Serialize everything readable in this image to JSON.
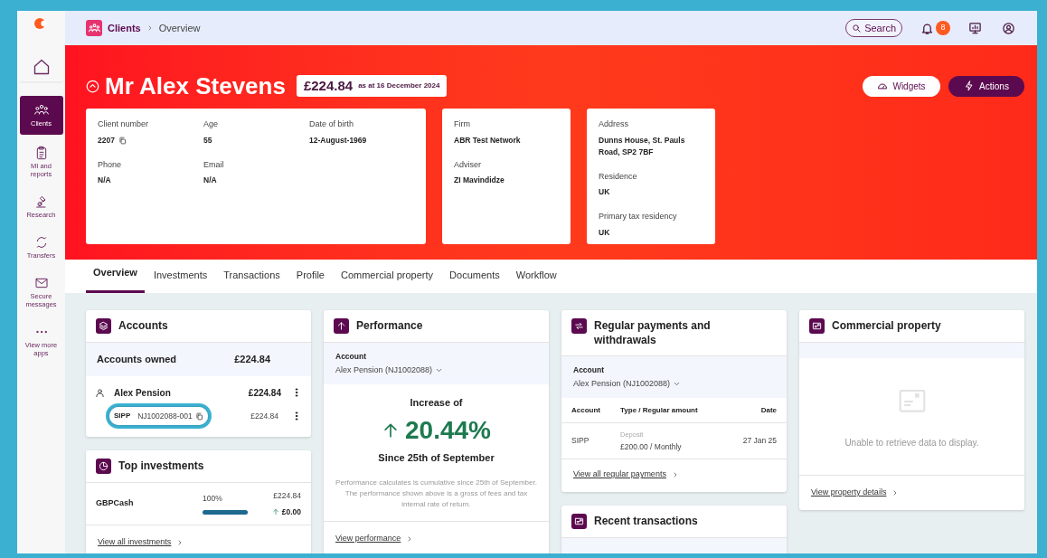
{
  "sidebar": {
    "items": [
      {
        "kind": "home",
        "selected": false
      },
      {
        "kind": "clients",
        "label": "Clients",
        "selected": true
      },
      {
        "kind": "reports",
        "label": "MI and reports",
        "selected": false
      },
      {
        "kind": "research",
        "label": "Research",
        "selected": false
      },
      {
        "kind": "transfers",
        "label": "Transfers",
        "selected": false
      },
      {
        "kind": "messages",
        "label": "Secure messages",
        "selected": false
      },
      {
        "kind": "more",
        "label": "View more apps",
        "selected": false
      }
    ]
  },
  "topbar": {
    "breadcrumb": [
      "Clients",
      "Overview"
    ],
    "search": "Search",
    "notification_count": "8"
  },
  "client": {
    "name": "Mr Alex Stevens",
    "value": "£224.84",
    "as_at": "as at 16 December 2024",
    "actions": [
      {
        "kind": "widgets",
        "label": "Widgets"
      },
      {
        "kind": "actions",
        "label": "Actions"
      }
    ]
  },
  "info_cards": [
    {
      "fields": [
        {
          "label": "Client number",
          "value": "2207",
          "copyable": true
        },
        {
          "label": "Age",
          "value": "55",
          "copyable": false
        },
        {
          "label": "Date of birth",
          "value": "12-August-1969",
          "copyable": false
        },
        {
          "label": "Phone",
          "value": "N/A",
          "copyable": false
        },
        {
          "label": "Email",
          "value": "N/A",
          "copyable": false
        }
      ]
    },
    {
      "fields": [
        {
          "label": "Firm",
          "value": "ABR Test Network",
          "copyable": false
        },
        {
          "label": "Adviser",
          "value": "ZI Mavindidze",
          "copyable": false
        }
      ]
    },
    {
      "fields": [
        {
          "label": "Address",
          "value": "Dunns House, St. Pauls Road, SP2 7BF",
          "copyable": false
        },
        {
          "label": "Residence",
          "value": "UK",
          "copyable": false
        },
        {
          "label": "Primary tax residency",
          "value": "UK",
          "copyable": false
        }
      ]
    }
  ],
  "tabs": [
    {
      "label": "Overview",
      "selected": true
    },
    {
      "label": "Investments",
      "selected": false
    },
    {
      "label": "Transactions",
      "selected": false
    },
    {
      "label": "Profile",
      "selected": false
    },
    {
      "label": "Commercial property",
      "selected": false
    },
    {
      "label": "Documents",
      "selected": false
    },
    {
      "label": "Workflow",
      "selected": false
    }
  ],
  "accounts": {
    "title": "Accounts",
    "summary_label": "Accounts owned",
    "summary_value": "£224.84",
    "accounts": [
      {
        "name": "Alex Pension",
        "value": "£224.84",
        "products": [
          {
            "type": "SIPP",
            "number": "NJ1002088-001",
            "value": "£224.84",
            "highlighted": true
          }
        ]
      }
    ]
  },
  "top_investments": {
    "title": "Top investments",
    "rows": [
      {
        "name": "GBPCash",
        "share": "100%",
        "level": 1,
        "value": "£224.84",
        "change": "£0.00"
      }
    ],
    "link": "View all investments"
  },
  "performance": {
    "title": "Performance",
    "account_label": "Account",
    "account": "Alex Pension (NJ1002088)",
    "heading": "Increase of",
    "change": "20.44%",
    "since": "Since 25th of September",
    "note": "Performance calculates is cumulative since 25th of September. The performance shown above is a gross of fees and tax internal rate of return.",
    "link": "View performance"
  },
  "regular_payments": {
    "title": "Regular payments and withdrawals",
    "account_label": "Account",
    "account": "Alex Pension (NJ1002088)",
    "columns": [
      "Account",
      "Type / Regular amount",
      "Date"
    ],
    "rows": [
      {
        "account": "SIPP",
        "type": "Deposit",
        "amount": "£200.00 / Monthly",
        "date": "27 Jan 25"
      }
    ],
    "link": "View all regular payments"
  },
  "recent_transactions": {
    "title": "Recent transactions"
  },
  "commercial_property": {
    "title": "Commercial property",
    "message": "Unable to retrieve data to display.",
    "link": "View property details"
  }
}
